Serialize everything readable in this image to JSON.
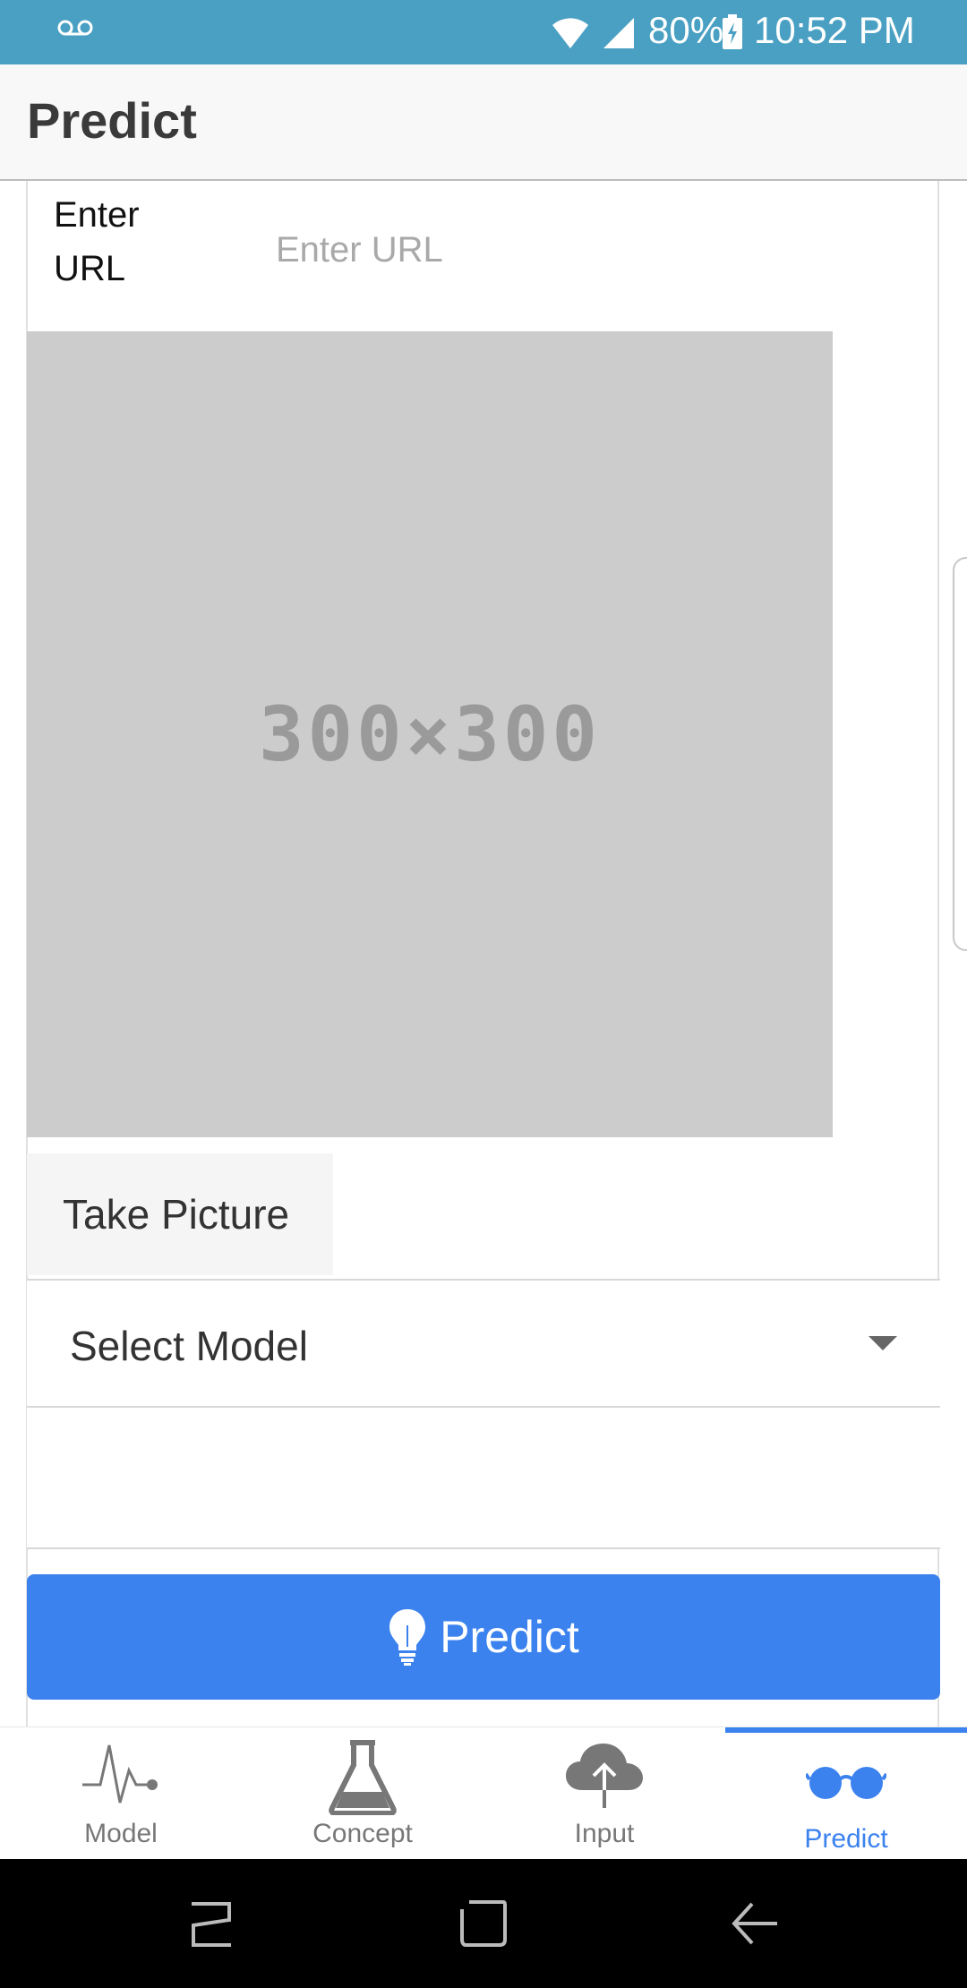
{
  "status_bar": {
    "battery_percent": "80%",
    "time": "10:52 PM"
  },
  "header": {
    "title": "Predict"
  },
  "url_field": {
    "label": "Enter URL",
    "placeholder": "Enter URL",
    "value": ""
  },
  "image_placeholder": {
    "text": "300×300"
  },
  "take_picture": {
    "label": "Take Picture"
  },
  "model_select": {
    "selected": "Select Model"
  },
  "predict_button": {
    "label": "Predict"
  },
  "tabs": [
    {
      "label": "Model",
      "icon": "pulse-icon"
    },
    {
      "label": "Concept",
      "icon": "flask-icon"
    },
    {
      "label": "Input",
      "icon": "cloud-upload-icon"
    },
    {
      "label": "Predict",
      "icon": "glasses-icon",
      "active": true
    }
  ],
  "colors": {
    "status_bar": "#4aa0c3",
    "accent": "#3b82ef",
    "image_bg": "#cccccc"
  }
}
